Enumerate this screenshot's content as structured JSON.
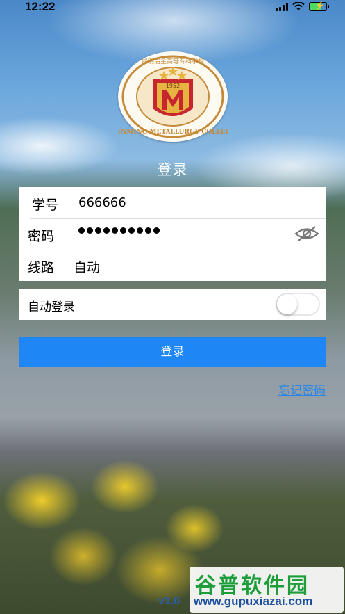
{
  "status_bar": {
    "time": "12:22"
  },
  "logo": {
    "year": "1952",
    "ring_text_en": "KUNMING METALLURGY COLLEGE",
    "ring_text_cn": "昆明冶金高等专科学校"
  },
  "page_title": "登录",
  "form": {
    "student_id_label": "学号",
    "student_id_value": "666666",
    "password_label": "密码",
    "password_length": 10,
    "route_label": "线路",
    "route_value": "自动"
  },
  "auto_login": {
    "label": "自动登录",
    "enabled": false
  },
  "login_button": "登录",
  "forgot_password": "忘记密码",
  "version": "v1.0",
  "watermark": {
    "title": "谷普软件园",
    "url": "www.gupuxiazai.com"
  }
}
